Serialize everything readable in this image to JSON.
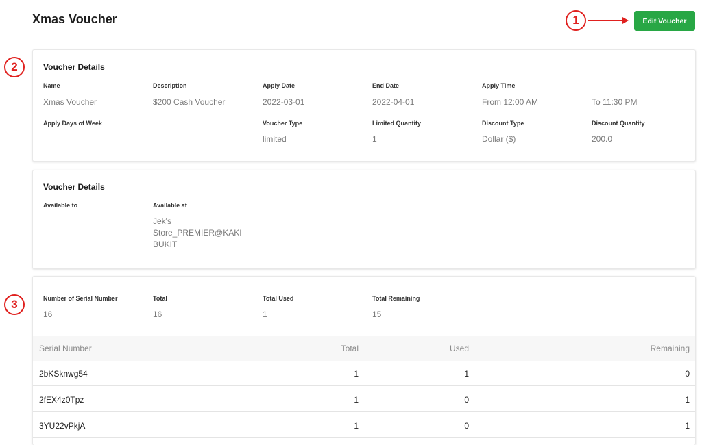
{
  "header": {
    "title": "Xmas Voucher",
    "edit_button_label": "Edit Voucher"
  },
  "annotations": [
    "1",
    "2",
    "3"
  ],
  "voucher_details": {
    "title": "Voucher Details",
    "name_label": "Name",
    "name_value": "Xmas Voucher",
    "description_label": "Description",
    "description_value": "$200 Cash Voucher",
    "apply_date_label": "Apply Date",
    "apply_date_value": "2022-03-01",
    "end_date_label": "End Date",
    "end_date_value": "2022-04-01",
    "apply_time_label": "Apply Time",
    "apply_time_from": "From 12:00 AM",
    "apply_time_to": "To 11:30 PM",
    "apply_days_label": "Apply Days of Week",
    "voucher_type_label": "Voucher Type",
    "voucher_type_value": "limited",
    "limited_quantity_label": "Limited Quantity",
    "limited_quantity_value": "1",
    "discount_type_label": "Discount Type",
    "discount_type_value": "Dollar ($)",
    "discount_quantity_label": "Discount Quantity",
    "discount_quantity_value": "200.0"
  },
  "availability": {
    "title": "Voucher Details",
    "available_to_label": "Available to",
    "available_at_label": "Available at",
    "available_at_lines": [
      "Jek's",
      "Store_PREMIER@KAKI",
      "BUKIT"
    ]
  },
  "serials": {
    "count_label": "Number of Serial Number",
    "count_value": "16",
    "total_label": "Total",
    "total_value": "16",
    "used_label": "Total Used",
    "used_value": "1",
    "remaining_label": "Total Remaining",
    "remaining_value": "15",
    "columns": [
      "Serial Number",
      "Total",
      "Used",
      "Remaining"
    ],
    "rows": [
      {
        "serial": "2bKSknwg54",
        "total": "1",
        "used": "1",
        "remaining": "0"
      },
      {
        "serial": "2fEX4z0Tpz",
        "total": "1",
        "used": "0",
        "remaining": "1"
      },
      {
        "serial": "3YU22vPkjA",
        "total": "1",
        "used": "0",
        "remaining": "1"
      }
    ]
  },
  "colors": {
    "accent_green": "#28a745",
    "annotation_red": "#e0211f"
  }
}
